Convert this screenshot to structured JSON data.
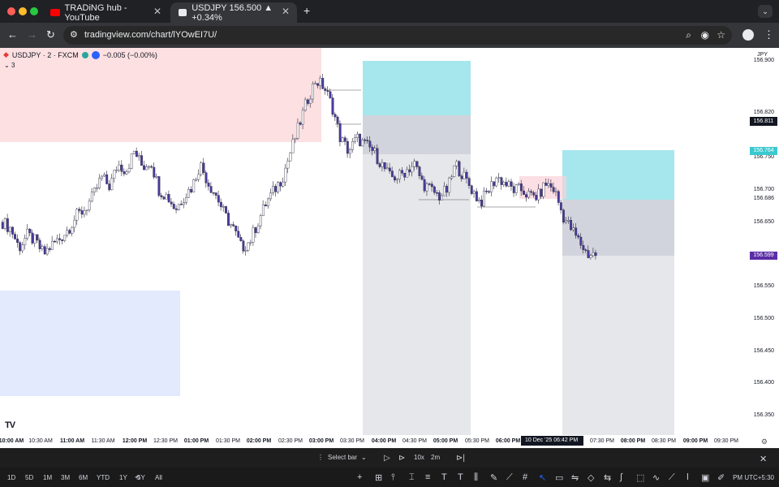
{
  "browser": {
    "tabs": [
      {
        "title": "TRADiNG hub - YouTube",
        "active": false,
        "favicon": "youtube-icon",
        "color": "#ff0000"
      },
      {
        "title": "USDJPY 156.500 ▲ +0.34%",
        "active": true,
        "favicon": "tradingview-icon",
        "color": "#e8eaed"
      }
    ],
    "new_tab": "+",
    "url": "tradingview.com/chart/lYOwEI7U/"
  },
  "chart": {
    "symbol": "USDJPY · 2 · FXCM",
    "change": "−0.005 (−0.00%)",
    "indicators_count": "3",
    "currency": "JPY",
    "logo": "TV",
    "crosshair_price": "156.811",
    "crosshair_date": "10 Dec '25   06:42 PM",
    "price_badges": [
      {
        "label": "156.764",
        "color": "#3bc9cf"
      },
      {
        "label": "156.599",
        "color": "#5b2ea6"
      }
    ],
    "colors": {
      "up": "#ffffff",
      "down": "#4a3aa0",
      "zone_red": "#fde0e2",
      "zone_blue": "#e3eafd",
      "target": "#a5e7ec",
      "stop": "#d1d4dc"
    }
  },
  "chart_data": {
    "type": "candlestick",
    "symbol": "USDJPY",
    "interval": "2",
    "x_ticks": [
      "10:00 AM",
      "10:30 AM",
      "11:00 AM",
      "11:30 AM",
      "12:00 PM",
      "12:30 PM",
      "01:00 PM",
      "01:30 PM",
      "02:00 PM",
      "02:30 PM",
      "03:00 PM",
      "03:30 PM",
      "04:00 PM",
      "04:30 PM",
      "05:00 PM",
      "05:30 PM",
      "06:00 PM",
      "07:30 PM",
      "08:00 PM",
      "08:30 PM",
      "09:00 PM",
      "09:30 PM"
    ],
    "x_ticks_bold": [
      "10:00 AM",
      "11:00 AM",
      "12:00 PM",
      "01:00 PM",
      "02:00 PM",
      "03:00 PM",
      "04:00 PM",
      "05:00 PM",
      "06:00 PM",
      "08:00 PM",
      "09:00 PM"
    ],
    "y_ticks": [
      "156.900",
      "156.820",
      "156.800",
      "156.750",
      "156.700",
      "156.686",
      "156.650",
      "156.550",
      "156.500",
      "156.450",
      "156.400",
      "156.350"
    ],
    "ylim": [
      156.32,
      156.92
    ],
    "close_path": [
      156.65,
      156.64,
      156.61,
      156.63,
      156.62,
      156.6,
      156.615,
      156.625,
      156.64,
      156.66,
      156.67,
      156.69,
      156.72,
      156.705,
      156.74,
      156.73,
      156.76,
      156.735,
      156.745,
      156.7,
      156.69,
      156.67,
      156.69,
      156.705,
      156.74,
      156.71,
      156.69,
      156.66,
      156.64,
      156.61,
      156.62,
      156.65,
      156.68,
      156.7,
      156.72,
      156.76,
      156.8,
      156.84,
      156.87,
      156.86,
      156.83,
      156.78,
      156.76,
      156.78,
      156.77,
      156.76,
      156.74,
      156.72,
      156.72,
      156.73,
      156.74,
      156.71,
      156.7,
      156.69,
      156.7,
      156.74,
      156.72,
      156.7,
      156.68,
      156.7,
      156.72,
      156.71,
      156.7,
      156.7,
      156.69,
      156.69,
      156.71,
      156.7,
      156.66,
      156.64,
      156.62,
      156.6,
      156.6
    ],
    "series": [
      {
        "name": "USDJPY",
        "last": 156.5
      }
    ]
  },
  "bottom": {
    "select_bar": "Select bar",
    "speed": "10x",
    "interval": "2m",
    "ranges": [
      "1D",
      "5D",
      "1M",
      "3M",
      "6M",
      "YTD",
      "1Y",
      "5Y",
      "All"
    ],
    "timezone": "PM UTC+5:30"
  }
}
